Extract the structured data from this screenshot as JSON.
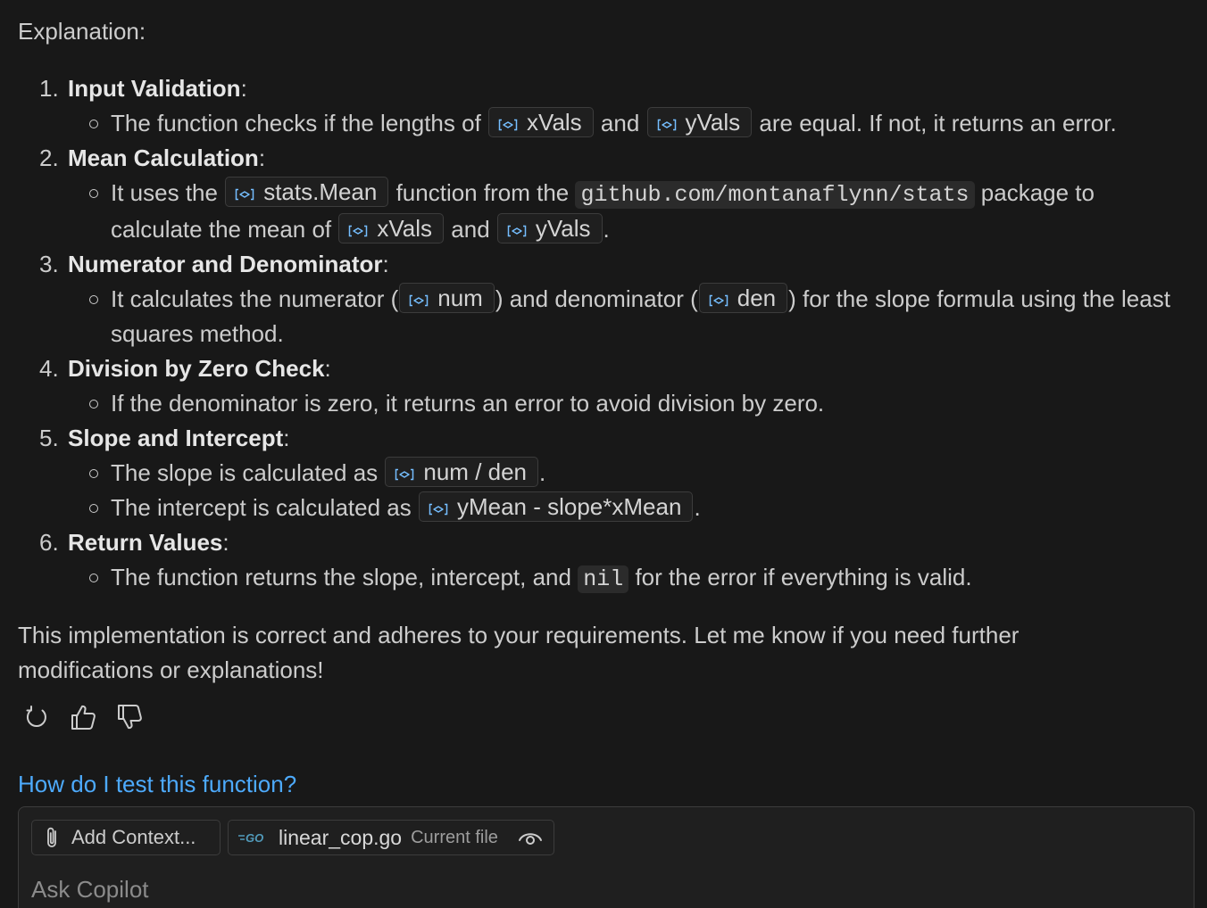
{
  "explanation_label": "Explanation:",
  "steps": [
    {
      "num": "1.",
      "title": "Input Validation",
      "bullets": [
        [
          "The function checks if the lengths of ",
          {
            "sym": "xVals"
          },
          " and ",
          {
            "sym": "yVals"
          },
          " are equal. If not, it returns an error."
        ]
      ]
    },
    {
      "num": "2.",
      "title": "Mean Calculation",
      "bullets": [
        [
          "It uses the ",
          {
            "sym": "stats.Mean"
          },
          " function from the ",
          {
            "code": "github.com/montanaflynn/stats"
          },
          " package to calculate the mean of ",
          {
            "sym": "xVals"
          },
          " and ",
          {
            "sym": "yVals"
          },
          "."
        ]
      ]
    },
    {
      "num": "3.",
      "title": "Numerator and Denominator",
      "bullets": [
        [
          "It calculates the numerator (",
          {
            "sym": "num"
          },
          ") and denominator (",
          {
            "sym": "den"
          },
          ") for the slope formula using the least squares method."
        ]
      ]
    },
    {
      "num": "4.",
      "title": "Division by Zero Check",
      "bullets": [
        [
          "If the denominator is zero, it returns an error to avoid division by zero."
        ]
      ]
    },
    {
      "num": "5.",
      "title": "Slope and Intercept",
      "bullets": [
        [
          "The slope is calculated as ",
          {
            "sym": "num / den"
          },
          "."
        ],
        [
          "The intercept is calculated as ",
          {
            "sym": "yMean - slope*xMean"
          },
          "."
        ]
      ]
    },
    {
      "num": "6.",
      "title": "Return Values",
      "bullets": [
        [
          "The function returns the slope, intercept, and ",
          {
            "code": "nil"
          },
          " for the error if everything is valid."
        ]
      ]
    }
  ],
  "closing": "This implementation is correct and adheres to your requirements. Let me know if you need further modifications or explanations!",
  "actions": {
    "retry_icon": "retry-icon",
    "like_icon": "thumbs-up-icon",
    "dislike_icon": "thumbs-down-icon"
  },
  "suggestion": "How do I test this function?",
  "chat_input": {
    "add_context_label": "Add Context...",
    "file_name": "linear_cop.go",
    "file_sub": "Current file",
    "placeholder": "Ask Copilot"
  },
  "colors": {
    "background": "#181818",
    "text": "#cccccc",
    "link": "#4daafc",
    "symbol_icon": "#75beff",
    "go_icon": "#519aba"
  }
}
